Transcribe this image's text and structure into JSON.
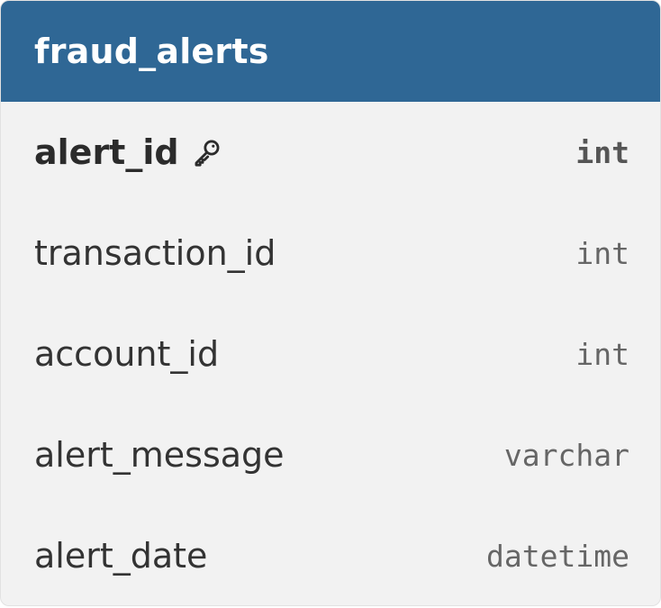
{
  "table": {
    "name": "fraud_alerts",
    "header_color": "#2f6795",
    "columns": [
      {
        "name": "alert_id",
        "type": "int",
        "primary_key": true,
        "icon": "key-icon"
      },
      {
        "name": "transaction_id",
        "type": "int",
        "primary_key": false
      },
      {
        "name": "account_id",
        "type": "int",
        "primary_key": false
      },
      {
        "name": "alert_message",
        "type": "varchar",
        "primary_key": false
      },
      {
        "name": "alert_date",
        "type": "datetime",
        "primary_key": false
      }
    ]
  }
}
